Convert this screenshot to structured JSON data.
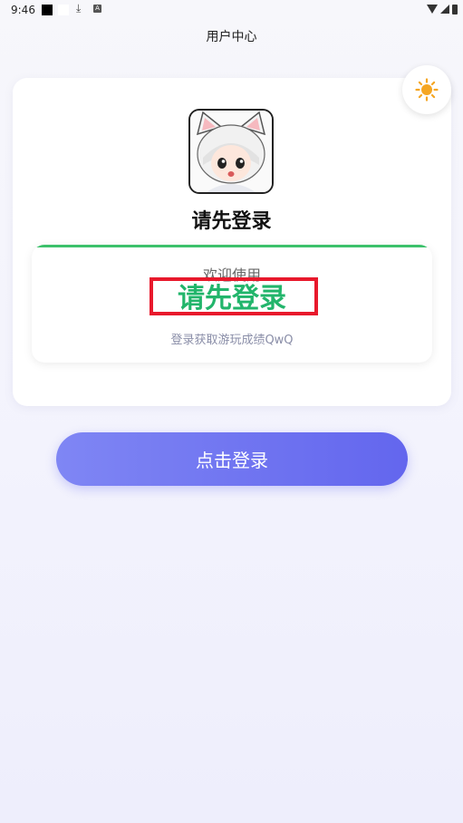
{
  "status_bar": {
    "time": "9:46",
    "download_glyph": "⤓",
    "app_badge": "A",
    "icons": [
      "black-square-icon",
      "white-square-icon",
      "download-icon",
      "a-notification-icon",
      "wifi-icon",
      "signal-icon",
      "battery-icon"
    ]
  },
  "header": {
    "title": "用户中心"
  },
  "profile": {
    "username": "请先登录",
    "avatar_icon": "anime-cat-girl-avatar"
  },
  "theme_toggle": {
    "icon": "sun-icon",
    "color": "#f5a623"
  },
  "welcome": {
    "label": "欢迎使用",
    "title": "请先登录",
    "subtitle": "登录获取游玩成绩QwQ",
    "accent_color": "#22b56b",
    "highlight_color": "#e8192c"
  },
  "actions": {
    "login_label": "点击登录",
    "button_color": "#6366ee"
  }
}
